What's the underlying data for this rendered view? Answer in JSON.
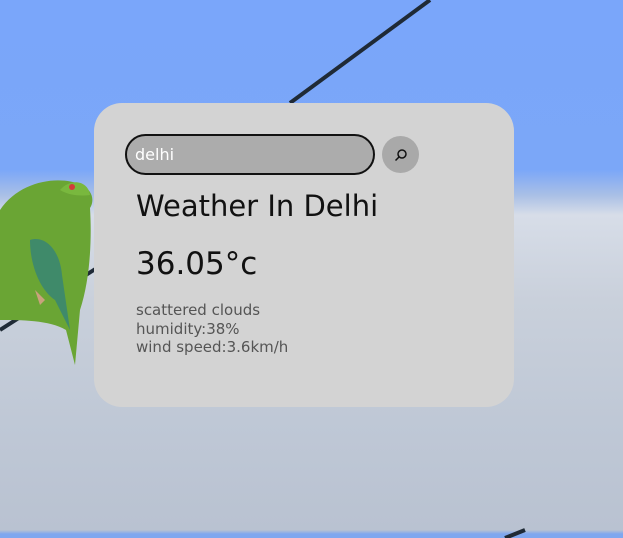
{
  "search": {
    "value": "delhi",
    "button_icon": "search-icon"
  },
  "weather": {
    "city_title": "Weather In Delhi",
    "temperature": "36.05°c",
    "description": "scattered clouds",
    "humidity": "humidity:38%",
    "wind_speed": "wind speed:3.6km/h"
  },
  "background": {
    "sky_color": "#7aa6fa",
    "card_color": "#d3d3d3"
  }
}
